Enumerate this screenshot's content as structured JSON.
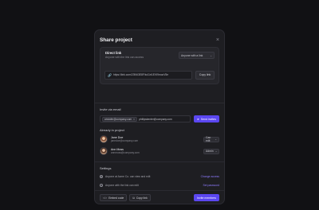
{
  "modal": {
    "title": "Share project",
    "close_icon": "×"
  },
  "direct_link": {
    "title": "Direct link",
    "subtitle": "Anyone with the link can access",
    "access_value": "Anyone with a link",
    "url": "https://link.com/2394i3E8F/tc41rt1E/K9mocV5e",
    "copy_label": "Copy link"
  },
  "invite": {
    "label": "Invite via email",
    "chip_email": "cristofer@company.com",
    "input_value": "phillipskenter@company.com",
    "send_label": "Send invites"
  },
  "members": {
    "label": "Already in project",
    "people": [
      {
        "name": "Jane Doe",
        "email": "janedoe@company.com",
        "role": "Can edit"
      },
      {
        "name": "Ann Moss",
        "email": "annmoss@company.com",
        "role": "Admin"
      }
    ]
  },
  "settings": {
    "label": "Settings",
    "items": [
      {
        "text": "Anyone at Acme Co. can view and edit",
        "action": "Change access"
      },
      {
        "text": "Anyone with the link can edit",
        "action": "Set password"
      }
    ]
  },
  "footer": {
    "embed_label": "Embed code",
    "copy_label": "Copy link",
    "invite_label": "Invite members"
  },
  "colors": {
    "accent": "#5b47f0",
    "link": "#8f7cff",
    "modal_bg": "#1e1e22",
    "page_bg": "#111114"
  },
  "icons": {
    "link": "link-icon",
    "send": "send-icon",
    "close": "close-icon",
    "globe": "globe-icon",
    "lock": "lock-icon",
    "code": "code-icon",
    "copy": "copy-icon"
  }
}
